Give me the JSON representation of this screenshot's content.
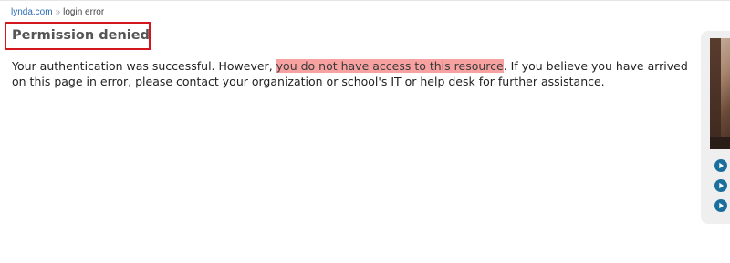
{
  "breadcrumb": {
    "home": "lynda.com",
    "separator": "»",
    "current": "login error"
  },
  "page": {
    "title": "Permission denied",
    "message_before": "Your authentication was successful. However, ",
    "message_highlight": "you do not have access to this resource",
    "message_after": ". If you believe you have arrived on this page in error, please contact your organization or school's IT or help desk for further assistance."
  },
  "sidebar": {
    "link_icons": [
      "play-arrow-icon",
      "play-arrow-icon",
      "play-arrow-icon"
    ],
    "colors": {
      "panel": "#efefef",
      "link_icon": "#1b6f9c"
    }
  },
  "colors": {
    "title_box_border": "#d4161d",
    "highlight": "#f7a1a1",
    "breadcrumb_link": "#2a6cb0"
  }
}
